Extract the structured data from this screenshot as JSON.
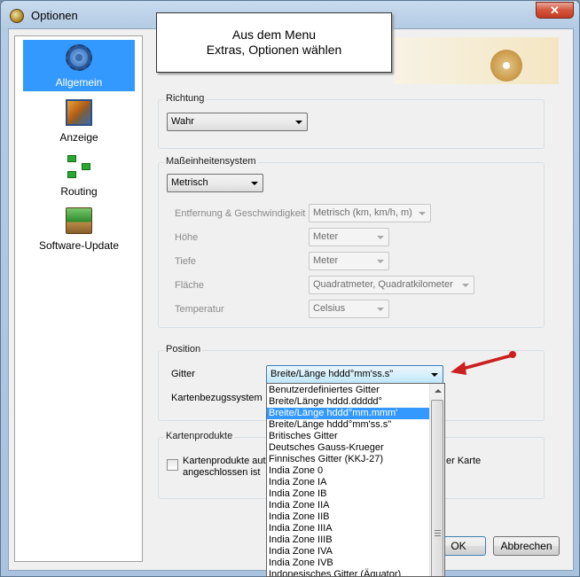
{
  "window": {
    "title": "Optionen",
    "close_glyph": "✕"
  },
  "callout": {
    "line1": "Aus dem Menu",
    "line2": "Extras, Optionen wählen"
  },
  "nav": {
    "items": [
      {
        "label": "Allgemein",
        "icon": "gear-icon",
        "selected": true
      },
      {
        "label": "Anzeige",
        "icon": "display-icon",
        "selected": false
      },
      {
        "label": "Routing",
        "icon": "routing-icon",
        "selected": false
      },
      {
        "label": "Software-Update",
        "icon": "software-update-icon",
        "selected": false
      }
    ]
  },
  "richtung": {
    "title": "Richtung",
    "value": "Wahr"
  },
  "units": {
    "title": "Maßeinheitensystem",
    "system": "Metrisch",
    "rows": [
      {
        "label": "Entfernung & Geschwindigkeit",
        "value": "Metrisch (km, km/h, m)"
      },
      {
        "label": "Höhe",
        "value": "Meter"
      },
      {
        "label": "Tiefe",
        "value": "Meter"
      },
      {
        "label": "Fläche",
        "value": "Quadratmeter, Quadratkilometer"
      },
      {
        "label": "Temperatur",
        "value": "Celsius"
      }
    ]
  },
  "position": {
    "title": "Position",
    "grid_label": "Gitter",
    "grid_value": "Breite/Länge hddd°mm'ss.s\"",
    "datum_label": "Kartenbezugssystem",
    "dropdown_options": [
      "Benutzerdefiniertes Gitter",
      "Breite/Länge hddd.ddddd°",
      "Breite/Länge hddd°mm.mmm'",
      "Breite/Länge hddd°mm'ss.s\"",
      "Britisches Gitter",
      "Deutsches Gauss-Krueger",
      "Finnisches Gitter (KKJ-27)",
      "India Zone 0",
      "India Zone IA",
      "India Zone IB",
      "India Zone IIA",
      "India Zone IIB",
      "India Zone IIIA",
      "India Zone IIIB",
      "India Zone IVA",
      "India Zone IVB",
      "Indonesisches Gitter (Äquator)"
    ],
    "highlighted_index": 2
  },
  "kartenprodukte": {
    "title": "Kartenprodukte",
    "checkbox_text_line1": "Kartenprodukte auto",
    "checkbox_text_line2": "angeschlossen ist",
    "checkbox_text_tail": "er Karte"
  },
  "buttons": {
    "ok": "OK",
    "cancel": "Abbrechen"
  },
  "colors": {
    "selection": "#3399ff",
    "arrow": "#cc1f1f"
  }
}
